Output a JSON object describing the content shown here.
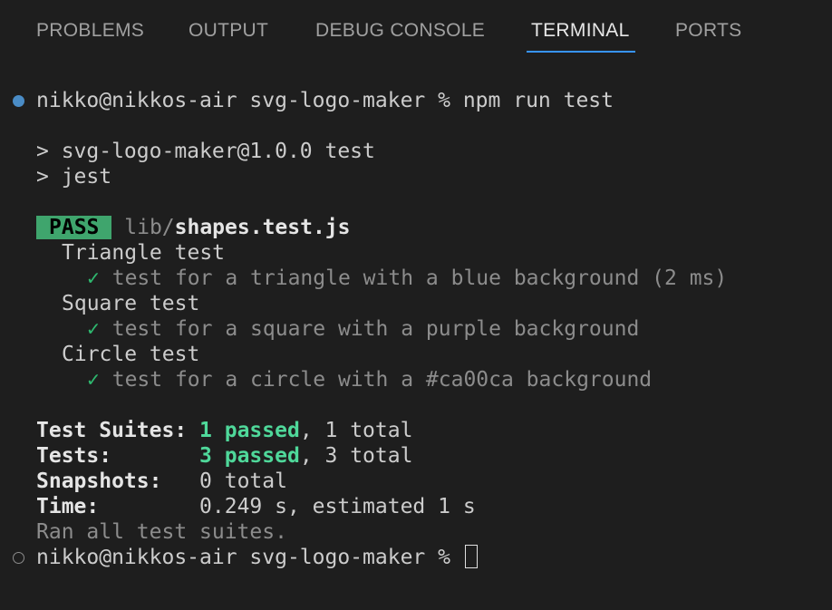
{
  "tabs": [
    {
      "label": "PROBLEMS"
    },
    {
      "label": "OUTPUT"
    },
    {
      "label": "DEBUG CONSOLE"
    },
    {
      "label": "TERMINAL"
    },
    {
      "label": "PORTS"
    }
  ],
  "active_tab": "TERMINAL",
  "colors": {
    "background": "#1e1e1e",
    "accent": "#3794ff",
    "pass_badge": "#3fa56d",
    "passed_text": "#4fd89a",
    "check_mark": "#2eb86f"
  },
  "terminal": {
    "prompt": "nikko@nikkos-air svg-logo-maker %",
    "command": "npm run test",
    "script_line1": "> svg-logo-maker@1.0.0 test",
    "script_line2": "> jest",
    "pass_label": "PASS",
    "test_dir": "lib/",
    "test_file": "shapes.test.js",
    "suites": [
      {
        "name": "Triangle test",
        "check": "✓",
        "test": "test for a triangle with a blue background (2 ms)"
      },
      {
        "name": "Square test",
        "check": "✓",
        "test": "test for a square with a purple background"
      },
      {
        "name": "Circle test",
        "check": "✓",
        "test": "test for a circle with a #ca00ca background"
      }
    ],
    "summary": {
      "suites_label": "Test Suites:",
      "suites_passed": "1 passed",
      "suites_total": ", 1 total",
      "tests_label": "Tests:",
      "tests_passed": "3 passed",
      "tests_total": ", 3 total",
      "snapshots_label": "Snapshots:",
      "snapshots_value": "0 total",
      "time_label": "Time:",
      "time_value": "0.249 s, estimated 1 s",
      "ran_all": "Ran all test suites."
    },
    "final_prompt": "nikko@nikkos-air svg-logo-maker %"
  }
}
